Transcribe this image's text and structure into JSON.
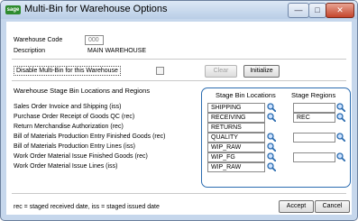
{
  "window": {
    "title": "Multi-Bin for Warehouse Options",
    "logo_text": "sage",
    "minimize_glyph": "—",
    "maximize_glyph": "□",
    "close_glyph": "✕"
  },
  "warehouse": {
    "code_label": "Warehouse Code",
    "code_value": "000",
    "description_label": "Description",
    "description_value": "MAIN WAREHOUSE"
  },
  "options": {
    "disable_label": "Disable Multi-Bin for this Warehouse",
    "disable_checked": false,
    "clear_label": "Clear",
    "initialize_label": "Initialize"
  },
  "section": {
    "title": "Warehouse Stage Bin Locations and Regions",
    "col_bin": "Stage Bin Locations",
    "col_region": "Stage Regions"
  },
  "rows": [
    {
      "label": "Sales Order Invoice and Shipping (iss)",
      "bin": "SHIPPING",
      "bin_lookup": true,
      "region": "",
      "region_field": true
    },
    {
      "label": "Purchase Order Receipt of Goods QC (rec)",
      "bin": "RECEIVING",
      "bin_lookup": true,
      "region": "REC",
      "region_field": true
    },
    {
      "label": "Return Merchandise Authorization (rec)",
      "bin": "RETURNS",
      "bin_lookup": false,
      "region": "",
      "region_field": false
    },
    {
      "label": "Bill of Materials Production Entry Finished Goods (rec)",
      "bin": "QUALITY",
      "bin_lookup": true,
      "region": "",
      "region_field": true
    },
    {
      "label": "Bill of Materials Production Entry Lines (iss)",
      "bin": "WIP_RAW",
      "bin_lookup": true,
      "region": "",
      "region_field": false
    },
    {
      "label": "Work Order Material Issue Finished Goods (rec)",
      "bin": "WIP_FG",
      "bin_lookup": true,
      "region": "",
      "region_field": true
    },
    {
      "label": "Work Order Material Issue Lines (iss)",
      "bin": "WIP_RAW",
      "bin_lookup": true,
      "region": "",
      "region_field": false
    }
  ],
  "footer": {
    "note": "rec = staged received date, iss = staged issued date",
    "accept_label": "Accept",
    "cancel_label": "Cancel"
  },
  "colors": {
    "accent": "#2b6cb0",
    "titlebar": "#c6d7ec"
  }
}
